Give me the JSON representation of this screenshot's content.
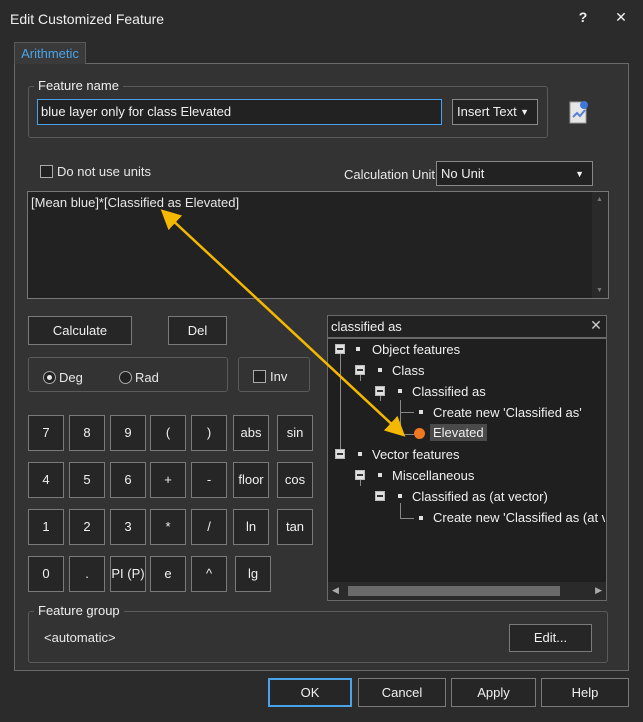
{
  "window": {
    "title": "Edit Customized Feature",
    "help_glyph": "?",
    "close_glyph": "✕"
  },
  "tab": {
    "label": "Arithmetic"
  },
  "feature_name": {
    "group_label": "Feature name",
    "value": "blue layer only for class Elevated",
    "insert_text_label": "Insert Text",
    "icon": "document-refresh-icon"
  },
  "units": {
    "no_units_label": "Do not use units",
    "no_units_checked": false,
    "calc_unit_label": "Calculation Unit:",
    "calc_unit_value": "No Unit"
  },
  "expression": {
    "text": "[Mean blue]*[Classified as Elevated]"
  },
  "buttons": {
    "calculate": "Calculate",
    "del": "Del",
    "inv": "Inv"
  },
  "angle": {
    "deg": "Deg",
    "rad": "Rad",
    "selected": "Deg"
  },
  "keypad": [
    [
      "7",
      "8",
      "9",
      "(",
      ")",
      "abs",
      "sin"
    ],
    [
      "4",
      "5",
      "6",
      "+",
      "-",
      "floor",
      "cos"
    ],
    [
      "1",
      "2",
      "3",
      "*",
      "/",
      "ln",
      "tan"
    ],
    [
      "0",
      ".",
      "PI (P)",
      "e",
      "^",
      "lg"
    ]
  ],
  "search": {
    "value": "classified as",
    "clear_glyph": "✕"
  },
  "tree": {
    "object_features": "Object features",
    "class": "Class",
    "classified_as": "Classified as",
    "create_new": "Create new 'Classified as'",
    "elevated": "Elevated",
    "vector_features": "Vector features",
    "miscellaneous": "Miscellaneous",
    "classified_vector": "Classified as (at vector)",
    "create_new_vector": "Create new 'Classified as (at v"
  },
  "feature_group": {
    "label": "Feature group",
    "value": "<automatic>",
    "edit_label": "Edit..."
  },
  "footer": {
    "ok": "OK",
    "cancel": "Cancel",
    "apply": "Apply",
    "help": "Help"
  },
  "colors": {
    "accent": "#4aa3e8",
    "annotation_arrow": "#f5b800",
    "elevated_dot": "#f07820"
  }
}
